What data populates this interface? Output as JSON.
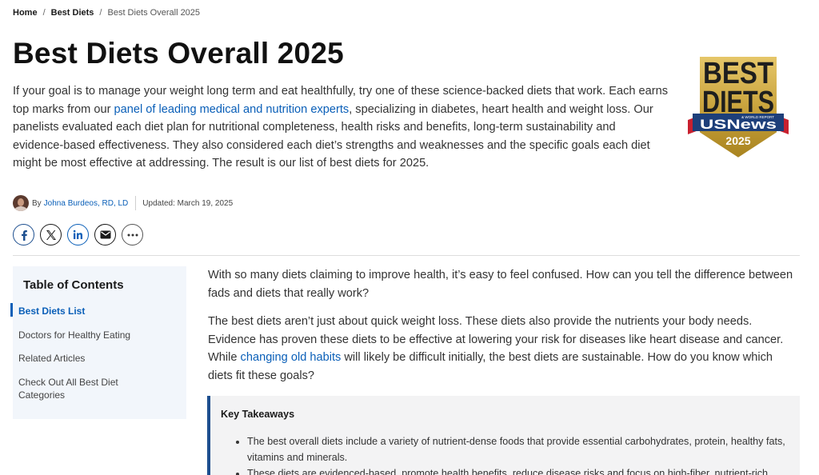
{
  "breadcrumb": {
    "home": "Home",
    "sep": "/",
    "section": "Best Diets",
    "current": "Best Diets Overall 2025"
  },
  "page_title": "Best Diets Overall 2025",
  "intro": {
    "before_link": "If your goal is to manage your weight long term and eat healthfully, try one of these science-backed diets that work. Each earns top marks from our ",
    "link": "panel of leading medical and nutrition experts",
    "after_link": ", specializing in diabetes, heart health and weight loss. Our panelists evaluated each diet plan for nutritional completeness, health risks and benefits, long-term sustainability and evidence-based effectiveness. They also considered each diet’s strengths and weaknesses and the specific goals each diet might be most effective at addressing. The result is our list of best diets for 2025."
  },
  "badge": {
    "line1": "BEST",
    "line2": "DIETS",
    "brand": "USNews",
    "brand_small": "& WORLD REPORT",
    "year": "2025",
    "colors": {
      "gold": "#c9a33d",
      "dark_gold": "#8a6a1f",
      "navy": "#1d3f7a",
      "red": "#c8202f"
    }
  },
  "byline": {
    "by": "By",
    "author": "Johna Burdeos, RD, LD",
    "updated": "Updated: March 19, 2025"
  },
  "share": {
    "icons": [
      "facebook-icon",
      "x-icon",
      "linkedin-icon",
      "email-icon",
      "more-icon"
    ]
  },
  "toc": {
    "title": "Table of Contents",
    "items": [
      {
        "label": "Best Diets List",
        "active": true
      },
      {
        "label": "Doctors for Healthy Eating",
        "active": false
      },
      {
        "label": "Related Articles",
        "active": false
      },
      {
        "label": "Check Out All Best Diet Categories",
        "active": false
      }
    ]
  },
  "body": {
    "p1": "With so many diets claiming to improve health, it’s easy to feel confused. How can you tell the difference between fads and diets that really work?",
    "p2_before": "The best diets aren’t just about quick weight loss. These diets also provide the nutrients your body needs. Evidence has proven these diets to be effective at lowering your risk for diseases like heart disease and cancer. While ",
    "p2_link": "changing old habits",
    "p2_after": " will likely be difficult initially, the best diets are sustainable. How do you know which diets fit these goals?"
  },
  "takeaways": {
    "title": "Key Takeaways",
    "items": [
      "The best overall diets include a variety of nutrient-dense foods that provide essential carbohydrates, protein, healthy fats, vitamins and minerals.",
      "These diets are evidenced-based, promote health benefits, reduce disease risks and focus on high-fiber, nutrient-rich"
    ]
  },
  "colors": {
    "link": "#0a5fb8",
    "toc_bg": "#f2f6fb",
    "takeaways_bg": "#f3f3f4",
    "takeaways_border": "#1d4f8f"
  }
}
